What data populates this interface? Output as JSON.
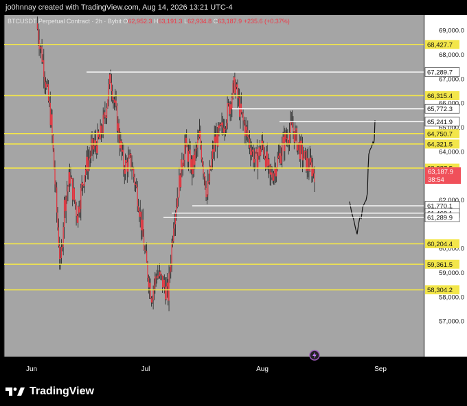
{
  "header": {
    "text": "jo0hnnay created with TradingView.com, Aug 14, 2026 13:21 UTC-4"
  },
  "legend": {
    "symbol": "BTCUSDT Perpetual Contract · 2h · Bybit",
    "o_label": "O",
    "o_value": "62,952.3",
    "h_label": "H",
    "h_value": "63,191.3",
    "l_label": "L",
    "l_value": "62,934.8",
    "c_label": "C",
    "c_value": "63,187.9",
    "change": "+235.6 (+0.37%)"
  },
  "brand": {
    "name": "TradingView"
  },
  "colors": {
    "plot_bg": "#a5a5a5",
    "candle": "#e8323d",
    "wick": "#1e1e1e",
    "hline_yellow": "#f3e64a",
    "hline_white": "#ffffff",
    "projection": "#111111",
    "price_badge": "#f0505a"
  },
  "chart_data": {
    "type": "candlestick",
    "symbol": "BTCUSDT",
    "timeframe": "2h",
    "exchange": "Bybit",
    "x_ticks": [
      "Jun",
      "Jul",
      "Aug",
      "Sep"
    ],
    "y_ticks": [
      {
        "value": 69000,
        "label": "69,000.0"
      },
      {
        "value": 68000,
        "label": "68,000.0"
      },
      {
        "value": 67000,
        "label": "67,000.0"
      },
      {
        "value": 66000,
        "label": "66,000.0"
      },
      {
        "value": 65000,
        "label": "65,000.0"
      },
      {
        "value": 64000,
        "label": "64,000.0"
      },
      {
        "value": 62000,
        "label": "62,000.0"
      },
      {
        "value": 60000,
        "label": "60,000.0"
      },
      {
        "value": 59000,
        "label": "59,000.0"
      },
      {
        "value": 58000,
        "label": "58,000.0"
      },
      {
        "value": 57000,
        "label": "57,000.0"
      }
    ],
    "ylim": [
      56200,
      69300
    ],
    "horizontal_levels": [
      {
        "value": 68427.7,
        "label": "68,427.7",
        "color": "yellow",
        "start": "full"
      },
      {
        "value": 67289.7,
        "label": "67,289.7",
        "color": "white",
        "start": "mid-Jun"
      },
      {
        "value": 66315.4,
        "label": "66,315.4",
        "color": "yellow",
        "start": "full"
      },
      {
        "value": 65772.3,
        "label": "65,772.3",
        "color": "white",
        "start": "late Jul"
      },
      {
        "value": 65241.9,
        "label": "65,241.9",
        "color": "white",
        "start": "early Aug"
      },
      {
        "value": 64750.7,
        "label": "64,750.7",
        "color": "yellow",
        "start": "full"
      },
      {
        "value": 64321.5,
        "label": "64,321.5",
        "color": "yellow",
        "start": "full"
      },
      {
        "value": 63327.5,
        "label": "63,327.5",
        "color": "yellow",
        "start": "full"
      },
      {
        "value": 61770.1,
        "label": "61,770.1",
        "color": "white",
        "start": "mid Jul"
      },
      {
        "value": 61468.1,
        "label": "61,468.1",
        "color": "white",
        "start": "early Jul"
      },
      {
        "value": 61289.9,
        "label": "61,289.9",
        "color": "white",
        "start": "early Jul"
      },
      {
        "value": 60204.4,
        "label": "60,204.4",
        "color": "yellow",
        "start": "full"
      },
      {
        "value": 59361.5,
        "label": "59,361.5",
        "color": "yellow",
        "start": "full"
      },
      {
        "value": 58304.2,
        "label": "58,304.2",
        "color": "yellow",
        "start": "full"
      }
    ],
    "current_price": {
      "value": 63187.9,
      "label": "63,187.9",
      "countdown": "38:54"
    },
    "price_path": [
      {
        "t": 0.0,
        "p": 69300
      },
      {
        "t": 0.02,
        "p": 67500
      },
      {
        "t": 0.04,
        "p": 65200
      },
      {
        "t": 0.055,
        "p": 61500
      },
      {
        "t": 0.065,
        "p": 59200
      },
      {
        "t": 0.075,
        "p": 61800
      },
      {
        "t": 0.09,
        "p": 63000
      },
      {
        "t": 0.11,
        "p": 61400
      },
      {
        "t": 0.13,
        "p": 63200
      },
      {
        "t": 0.15,
        "p": 64100
      },
      {
        "t": 0.17,
        "p": 64500
      },
      {
        "t": 0.185,
        "p": 65500
      },
      {
        "t": 0.2,
        "p": 67100
      },
      {
        "t": 0.215,
        "p": 65500
      },
      {
        "t": 0.235,
        "p": 63400
      },
      {
        "t": 0.255,
        "p": 63600
      },
      {
        "t": 0.275,
        "p": 62000
      },
      {
        "t": 0.295,
        "p": 59500
      },
      {
        "t": 0.31,
        "p": 58100
      },
      {
        "t": 0.325,
        "p": 59000
      },
      {
        "t": 0.34,
        "p": 58600
      },
      {
        "t": 0.355,
        "p": 58100
      },
      {
        "t": 0.37,
        "p": 61200
      },
      {
        "t": 0.385,
        "p": 62700
      },
      {
        "t": 0.4,
        "p": 64300
      },
      {
        "t": 0.42,
        "p": 63300
      },
      {
        "t": 0.44,
        "p": 64600
      },
      {
        "t": 0.46,
        "p": 62200
      },
      {
        "t": 0.48,
        "p": 64400
      },
      {
        "t": 0.5,
        "p": 64900
      },
      {
        "t": 0.52,
        "p": 65900
      },
      {
        "t": 0.535,
        "p": 66800
      },
      {
        "t": 0.55,
        "p": 65600
      },
      {
        "t": 0.57,
        "p": 64600
      },
      {
        "t": 0.59,
        "p": 63600
      },
      {
        "t": 0.61,
        "p": 64300
      },
      {
        "t": 0.63,
        "p": 62900
      },
      {
        "t": 0.65,
        "p": 63600
      },
      {
        "t": 0.67,
        "p": 64500
      },
      {
        "t": 0.69,
        "p": 65000
      },
      {
        "t": 0.71,
        "p": 64100
      },
      {
        "t": 0.73,
        "p": 63500
      },
      {
        "t": 0.75,
        "p": 63187.9
      }
    ]
  }
}
